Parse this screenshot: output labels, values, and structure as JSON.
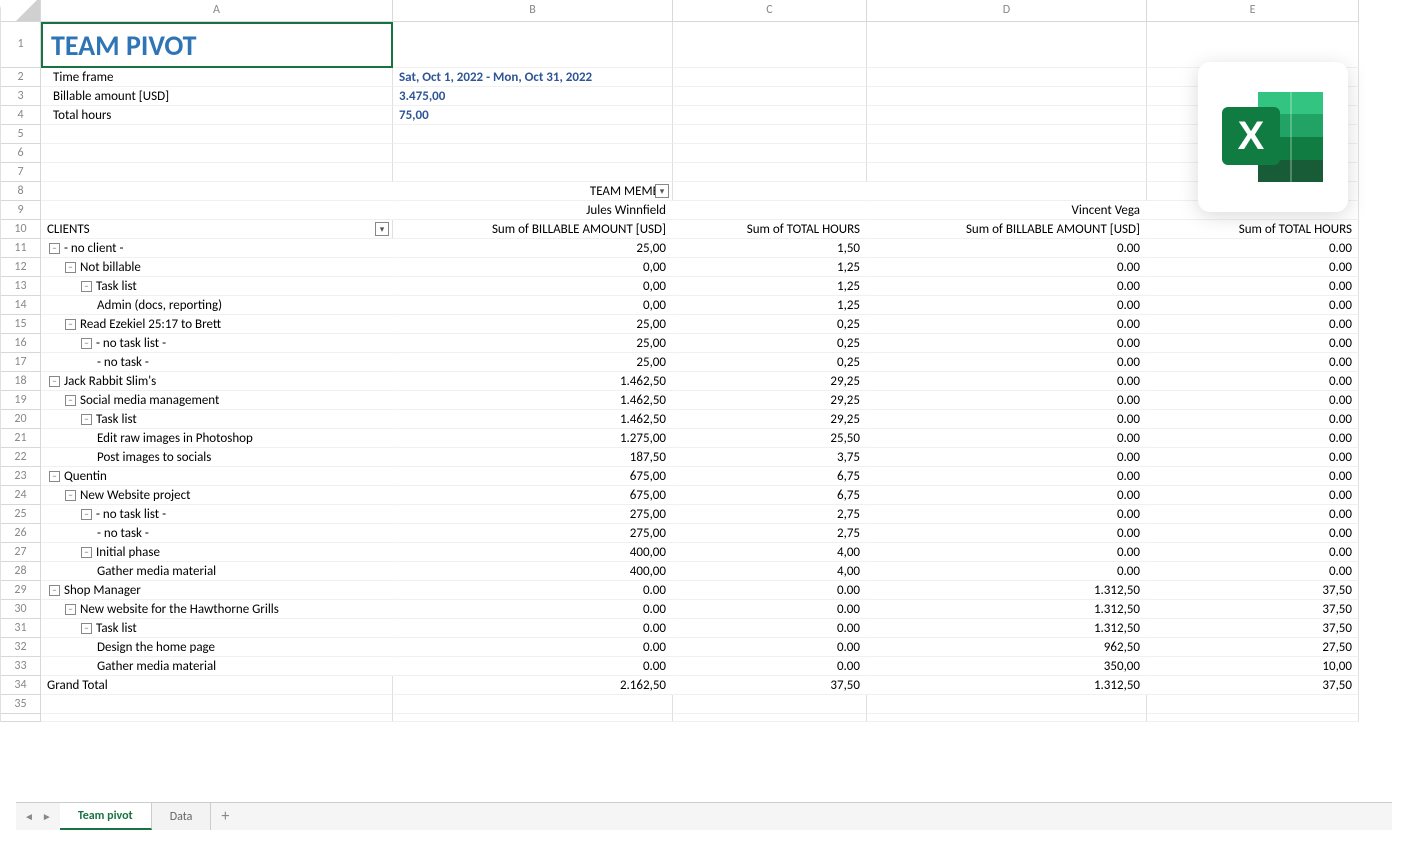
{
  "columns": [
    "A",
    "B",
    "C",
    "D",
    "E"
  ],
  "title": "TEAM PIVOT",
  "header": {
    "time_frame_label": "Time frame",
    "time_frame_value": "Sat, Oct 1, 2022 - Mon, Oct 31, 2022",
    "billable_label": "Billable amount [USD]",
    "billable_value": "3.475,00",
    "hours_label": "Total hours",
    "hours_value": "75,00"
  },
  "pivot": {
    "team_member_label": "TEAM MEMBE",
    "member1": "Jules Winnfield",
    "member2": "Vincent Vega",
    "clients_label": "CLIENTS",
    "col_b": "Sum of BILLABLE AMOUNT [USD]",
    "col_c": "Sum of TOTAL HOURS",
    "col_d": "Sum of BILLABLE AMOUNT [USD]",
    "col_e": "Sum of TOTAL HOURS"
  },
  "rows": [
    {
      "i": 1,
      "l": "- no client -",
      "b": "25,00",
      "c": "1,50",
      "d": "0.00",
      "e": "0.00",
      "lvl": 1,
      "exp": true
    },
    {
      "i": 2,
      "l": "Not billable",
      "b": "0,00",
      "c": "1,25",
      "d": "0.00",
      "e": "0.00",
      "lvl": 2,
      "exp": true
    },
    {
      "i": 3,
      "l": "Task list",
      "b": "0,00",
      "c": "1,25",
      "d": "0.00",
      "e": "0.00",
      "lvl": 3,
      "exp": true
    },
    {
      "i": 4,
      "l": "Admin (docs, reporting)",
      "b": "0,00",
      "c": "1,25",
      "d": "0.00",
      "e": "0.00",
      "lvl": 4,
      "exp": false
    },
    {
      "i": 5,
      "l": "Read Ezekiel 25:17 to Brett",
      "b": "25,00",
      "c": "0,25",
      "d": "0.00",
      "e": "0.00",
      "lvl": 2,
      "exp": true
    },
    {
      "i": 6,
      "l": "- no task list -",
      "b": "25,00",
      "c": "0,25",
      "d": "0.00",
      "e": "0.00",
      "lvl": 3,
      "exp": true
    },
    {
      "i": 7,
      "l": "- no task -",
      "b": "25,00",
      "c": "0,25",
      "d": "0.00",
      "e": "0.00",
      "lvl": 4,
      "exp": false
    },
    {
      "i": 8,
      "l": "Jack Rabbit Slim's",
      "b": "1.462,50",
      "c": "29,25",
      "d": "0.00",
      "e": "0.00",
      "lvl": 1,
      "exp": true
    },
    {
      "i": 9,
      "l": "Social media management",
      "b": "1.462,50",
      "c": "29,25",
      "d": "0.00",
      "e": "0.00",
      "lvl": 2,
      "exp": true
    },
    {
      "i": 10,
      "l": "Task list",
      "b": "1.462,50",
      "c": "29,25",
      "d": "0.00",
      "e": "0.00",
      "lvl": 3,
      "exp": true
    },
    {
      "i": 11,
      "l": "Edit raw images in Photoshop",
      "b": "1.275,00",
      "c": "25,50",
      "d": "0.00",
      "e": "0.00",
      "lvl": 4,
      "exp": false
    },
    {
      "i": 12,
      "l": "Post images to socials",
      "b": "187,50",
      "c": "3,75",
      "d": "0.00",
      "e": "0.00",
      "lvl": 4,
      "exp": false
    },
    {
      "i": 13,
      "l": "Quentin",
      "b": "675,00",
      "c": "6,75",
      "d": "0.00",
      "e": "0.00",
      "lvl": 1,
      "exp": true
    },
    {
      "i": 14,
      "l": "New Website project",
      "b": "675,00",
      "c": "6,75",
      "d": "0.00",
      "e": "0.00",
      "lvl": 2,
      "exp": true
    },
    {
      "i": 15,
      "l": "- no task list -",
      "b": "275,00",
      "c": "2,75",
      "d": "0.00",
      "e": "0.00",
      "lvl": 3,
      "exp": true
    },
    {
      "i": 16,
      "l": "- no task -",
      "b": "275,00",
      "c": "2,75",
      "d": "0.00",
      "e": "0.00",
      "lvl": 4,
      "exp": false
    },
    {
      "i": 17,
      "l": "Initial phase",
      "b": "400,00",
      "c": "4,00",
      "d": "0.00",
      "e": "0.00",
      "lvl": 3,
      "exp": true
    },
    {
      "i": 18,
      "l": "Gather media material",
      "b": "400,00",
      "c": "4,00",
      "d": "0.00",
      "e": "0.00",
      "lvl": 4,
      "exp": false
    },
    {
      "i": 19,
      "l": "Shop Manager",
      "b": "0.00",
      "c": "0.00",
      "d": "1.312,50",
      "e": "37,50",
      "lvl": 1,
      "exp": true
    },
    {
      "i": 20,
      "l": "New website for the Hawthorne Grills",
      "b": "0.00",
      "c": "0.00",
      "d": "1.312,50",
      "e": "37,50",
      "lvl": 2,
      "exp": true
    },
    {
      "i": 21,
      "l": "Task list",
      "b": "0.00",
      "c": "0.00",
      "d": "1.312,50",
      "e": "37,50",
      "lvl": 3,
      "exp": true
    },
    {
      "i": 22,
      "l": "Design the home page",
      "b": "0.00",
      "c": "0.00",
      "d": "962,50",
      "e": "27,50",
      "lvl": 4,
      "exp": false
    },
    {
      "i": 23,
      "l": "Gather media material",
      "b": "0.00",
      "c": "0.00",
      "d": "350,00",
      "e": "10,00",
      "lvl": 4,
      "exp": false
    }
  ],
  "totals": {
    "label": "Grand Total",
    "b": "2.162,50",
    "c": "37,50",
    "d": "1.312,50",
    "e": "37,50"
  },
  "tabs": {
    "active": "Team pivot",
    "other": "Data",
    "add": "+"
  },
  "icons": {
    "minus": "−",
    "dd": "▾",
    "prev": "◄",
    "next": "►"
  }
}
